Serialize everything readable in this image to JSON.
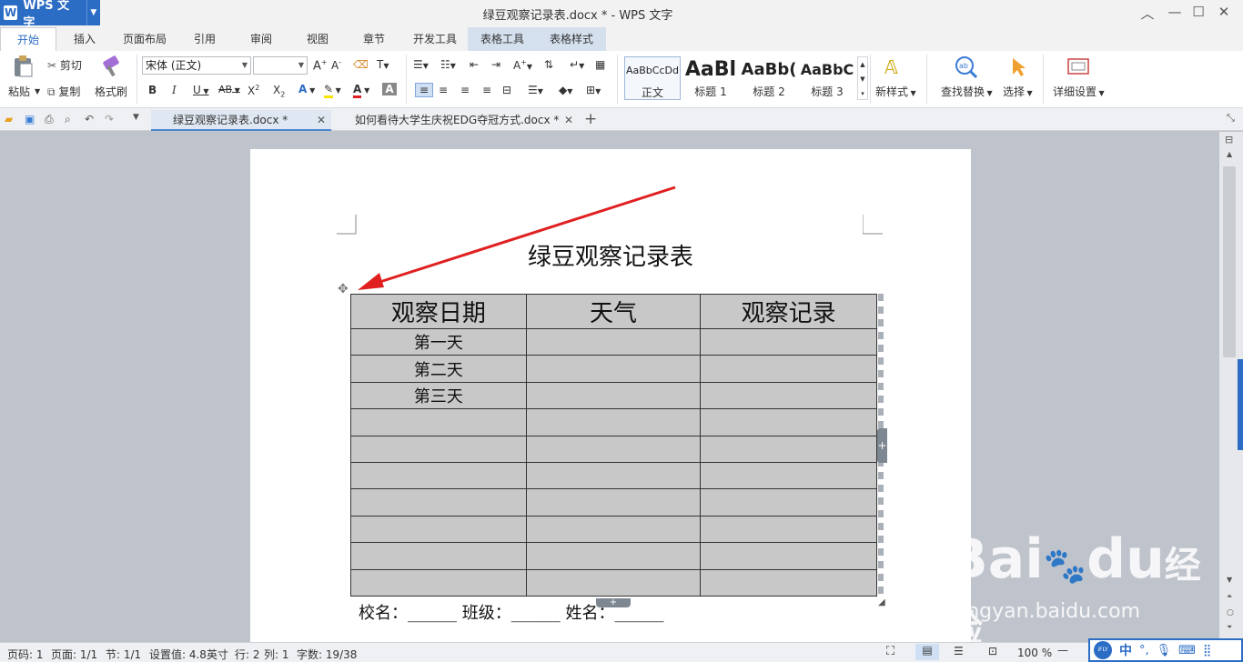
{
  "app": {
    "name": "WPS 文字",
    "window_title": "绿豆观察记录表.docx * - WPS 文字"
  },
  "ribbon_tabs": [
    {
      "label": "开始",
      "active": true
    },
    {
      "label": "插入"
    },
    {
      "label": "页面布局"
    },
    {
      "label": "引用"
    },
    {
      "label": "审阅"
    },
    {
      "label": "视图"
    },
    {
      "label": "章节"
    },
    {
      "label": "开发工具"
    },
    {
      "label": "表格工具",
      "contextual": true
    },
    {
      "label": "表格样式",
      "contextual": true
    }
  ],
  "ribbon": {
    "paste": "粘贴",
    "cut": "剪切",
    "copy": "复制",
    "format_painter": "格式刷",
    "font_name": "宋体 (正文)",
    "font_size": "",
    "styles": [
      {
        "sample": "AaBbCcDd",
        "label": "正文"
      },
      {
        "sample": "AaBl",
        "label": "标题 1"
      },
      {
        "sample": "AaBb(",
        "label": "标题 2"
      },
      {
        "sample": "AaBbC",
        "label": "标题 3"
      }
    ],
    "new_style": "新样式",
    "find_replace": "查找替换",
    "select": "选择",
    "detail_settings": "详细设置"
  },
  "doc_tabs": [
    {
      "label": "绿豆观察记录表.docx *",
      "active": true
    },
    {
      "label": "如何看待大学生庆祝EDG夺冠方式.docx *",
      "active": false
    }
  ],
  "document": {
    "title": "绿豆观察记录表",
    "table": {
      "headers": [
        "观察日期",
        "天气",
        "观察记录"
      ],
      "rows": [
        [
          "第一天",
          "",
          ""
        ],
        [
          "第二天",
          "",
          ""
        ],
        [
          "第三天",
          "",
          ""
        ],
        [
          "",
          "",
          ""
        ],
        [
          "",
          "",
          ""
        ],
        [
          "",
          "",
          ""
        ],
        [
          "",
          "",
          ""
        ],
        [
          "",
          "",
          ""
        ],
        [
          "",
          "",
          ""
        ],
        [
          "",
          "",
          ""
        ]
      ]
    },
    "footer_line": "校名：______    班级：______    姓名：______"
  },
  "status": {
    "page_num": "页码: 1",
    "pages": "页面: 1/1",
    "section": "节: 1/1",
    "setting": "设置值: 4.8英寸",
    "line": "行: 2",
    "col": "列: 1",
    "words": "字数: 19/38",
    "zoom": "100 %"
  },
  "watermark": {
    "brand": "Bai",
    "brand2": "du",
    "brand3": "经验",
    "url": "jingyan.baidu.com"
  },
  "ime": {
    "badge": "iFLY",
    "lang": "中"
  },
  "colors": {
    "accent": "#2b6cc4",
    "arrow": "#e02020",
    "table_fill": "#c8c8c8"
  }
}
